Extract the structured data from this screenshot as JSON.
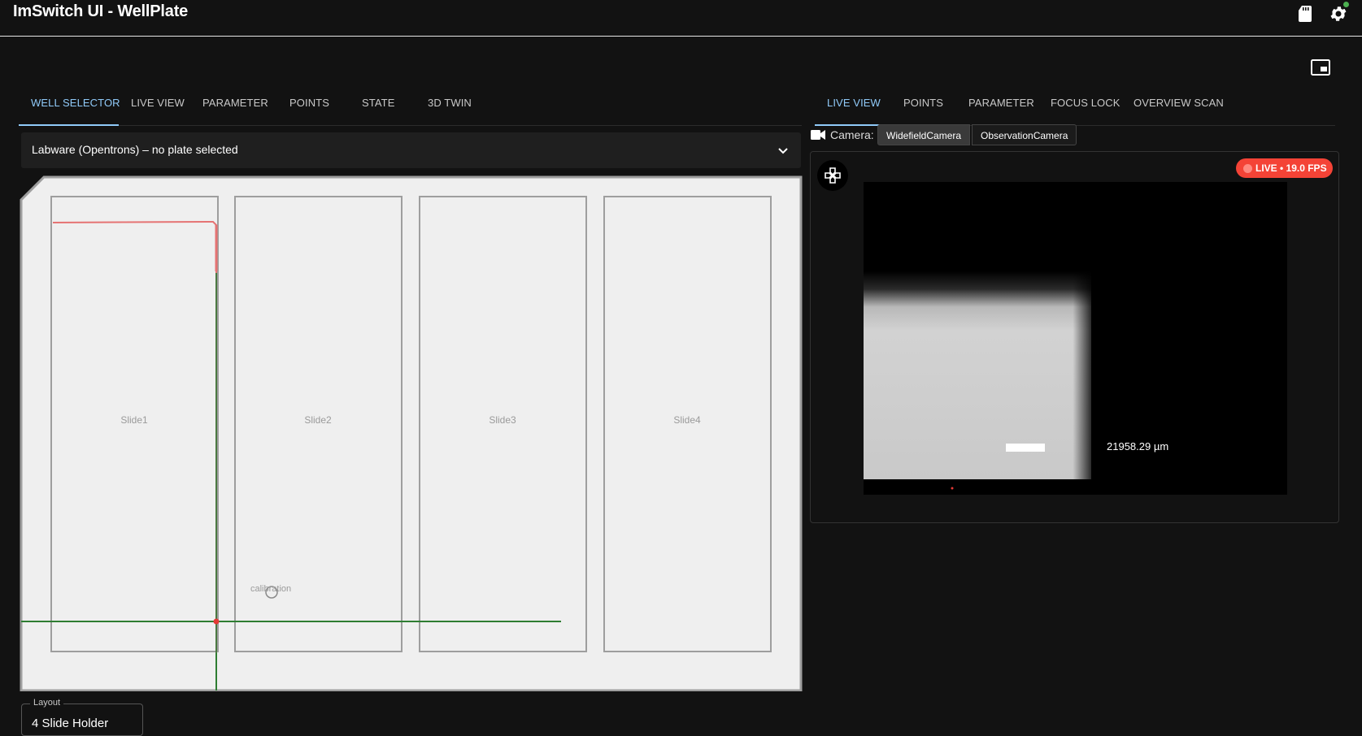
{
  "app": {
    "title": "ImSwitch UI - WellPlate",
    "icons": {
      "sd": "sd-card-icon",
      "settings": "gear-icon",
      "pip": "picture-in-picture-icon"
    },
    "accent_color": "#90caf9"
  },
  "left_tabs": [
    {
      "label": "WELL SELECTOR",
      "active": true
    },
    {
      "label": "LIVE VIEW",
      "active": false
    },
    {
      "label": "PARAMETER",
      "active": false
    },
    {
      "label": "POINTS",
      "active": false
    },
    {
      "label": "STATE",
      "active": false
    },
    {
      "label": "3D TWIN",
      "active": false
    }
  ],
  "accordion": {
    "title": "Labware (Opentrons) – no plate selected",
    "icon": "chevron-down-icon"
  },
  "plate": {
    "slides": [
      "Slide1",
      "Slide2",
      "Slide3",
      "Slide4"
    ],
    "calibration_label": "calibration",
    "colors": {
      "background": "#efefef",
      "outline": "#9e9e9e",
      "crosshair": "#2e7d32",
      "fov": "#e57373",
      "position_dot": "#e53935"
    }
  },
  "layout_select": {
    "legend": "Layout",
    "value": "4 Slide Holder"
  },
  "right_tabs": [
    {
      "label": "LIVE VIEW",
      "active": true
    },
    {
      "label": "POINTS",
      "active": false
    },
    {
      "label": "PARAMETER",
      "active": false
    },
    {
      "label": "FOCUS LOCK",
      "active": false
    },
    {
      "label": "OVERVIEW SCAN",
      "active": false
    }
  ],
  "camera": {
    "label": "Camera:",
    "icon": "videocam-icon",
    "options": [
      "WidefieldCamera",
      "ObservationCamera"
    ],
    "selected": "WidefieldCamera"
  },
  "live": {
    "badge": "LIVE • 19.0 FPS",
    "badge_color": "#f44336",
    "scale_bar_text": "21958.29 µm",
    "joystick_icon": "gamepad-icon"
  }
}
